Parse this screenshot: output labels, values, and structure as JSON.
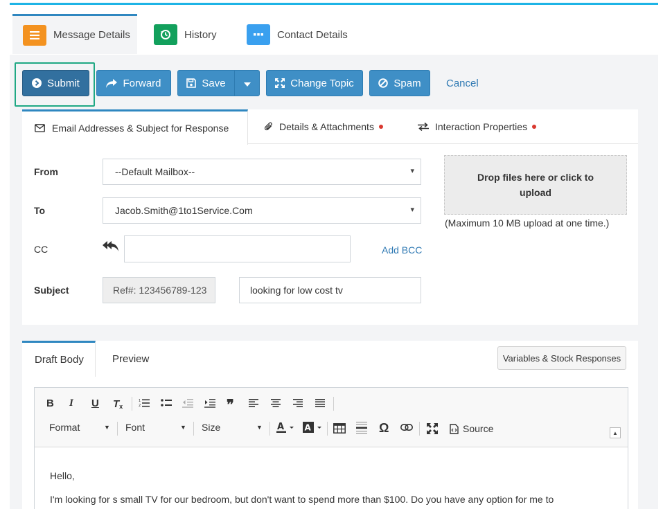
{
  "top_tabs": [
    {
      "label": "Message Details",
      "icon": "list-icon",
      "color": "#f39220",
      "active": true
    },
    {
      "label": "History",
      "icon": "history-icon",
      "color": "#12a05c",
      "active": false
    },
    {
      "label": "Contact Details",
      "icon": "dots-icon",
      "color": "#3aa0ef",
      "active": false
    }
  ],
  "toolbar": {
    "submit_label": "Submit",
    "forward_label": "Forward",
    "save_label": "Save",
    "change_topic_label": "Change Topic",
    "spam_label": "Spam",
    "cancel_label": "Cancel"
  },
  "form_tabs": [
    {
      "label": "Email Addresses & Subject for Response",
      "active": true
    },
    {
      "label": "Details & Attachments",
      "alert": true
    },
    {
      "label": "Interaction Properties",
      "alert": true
    }
  ],
  "form": {
    "from_label": "From",
    "from_value": "--Default Mailbox--",
    "to_label": "To",
    "to_value": "Jacob.Smith@1to1Service.Com",
    "cc_label": "CC",
    "cc_value": "",
    "add_bcc_label": "Add BCC",
    "subject_label": "Subject",
    "subject_ref": "Ref#: 123456789-123",
    "subject_value": "looking for low cost tv"
  },
  "upload": {
    "dropzone_text": "Drop files here or click to upload",
    "note": "(Maximum 10 MB upload at one time.)"
  },
  "body_tabs": {
    "draft_label": "Draft Body",
    "preview_label": "Preview",
    "variables_label": "Variables & Stock Responses"
  },
  "editor": {
    "format_label": "Format",
    "font_label": "Font",
    "size_label": "Size",
    "source_label": "Source",
    "content_line1": "Hello,",
    "content_line2": "I'm looking for s small TV for our bedroom, but don't want to spend more than $100. Do you have any option for me to"
  },
  "colors": {
    "accent": "#2f87c0",
    "button": "#3f8fc6",
    "submit": "#32709f",
    "highlight": "#1fa884",
    "alert": "#d9382f"
  }
}
